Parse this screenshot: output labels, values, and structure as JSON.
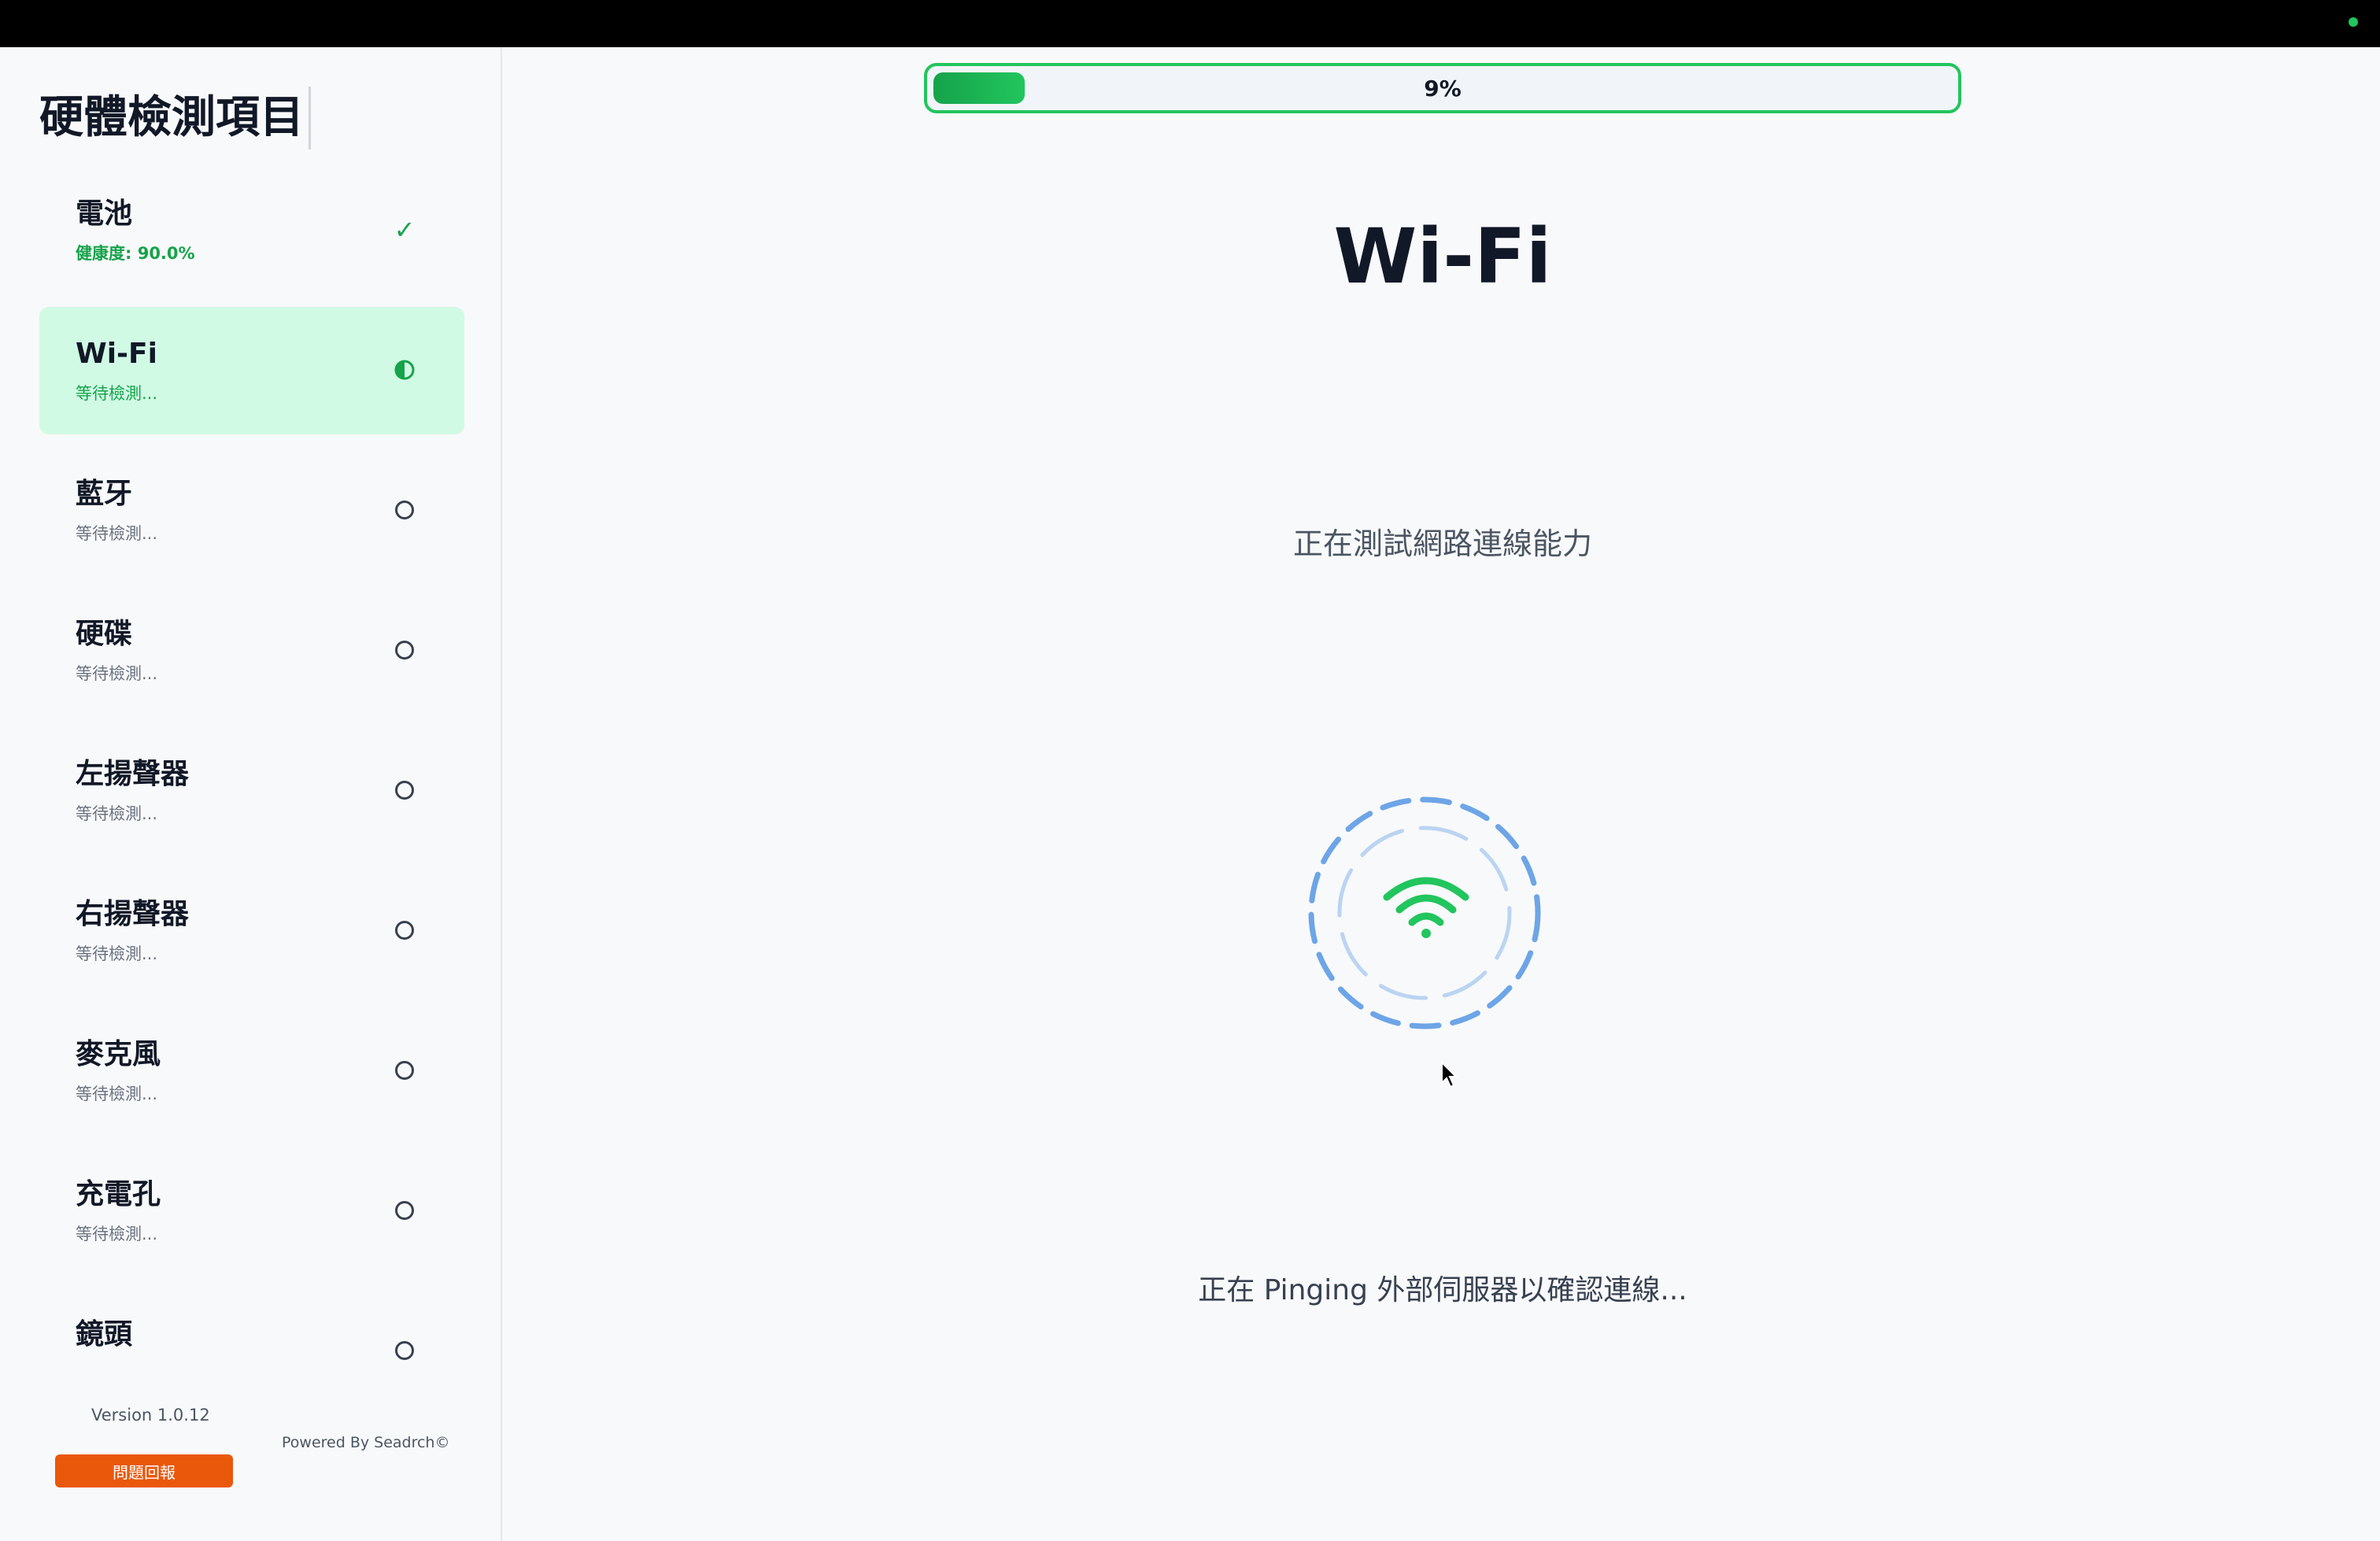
{
  "window": {
    "status_color": "#22c55e"
  },
  "sidebar": {
    "title": "硬體檢測項目",
    "items": [
      {
        "name": "電池",
        "status": "健康度: 90.0%",
        "state": "done",
        "icon": "check-icon"
      },
      {
        "name": "Wi-Fi",
        "status": "等待檢測...",
        "state": "active",
        "icon": "half-circle-icon"
      },
      {
        "name": "藍牙",
        "status": "等待檢測...",
        "state": "waiting",
        "icon": "circle-icon"
      },
      {
        "name": "硬碟",
        "status": "等待檢測...",
        "state": "waiting",
        "icon": "circle-icon"
      },
      {
        "name": "左揚聲器",
        "status": "等待檢測...",
        "state": "waiting",
        "icon": "circle-icon"
      },
      {
        "name": "右揚聲器",
        "status": "等待檢測...",
        "state": "waiting",
        "icon": "circle-icon"
      },
      {
        "name": "麥克風",
        "status": "等待檢測...",
        "state": "waiting",
        "icon": "circle-icon"
      },
      {
        "name": "充電孔",
        "status": "等待檢測...",
        "state": "waiting",
        "icon": "circle-icon"
      },
      {
        "name": "鏡頭",
        "status": "",
        "state": "waiting",
        "icon": "circle-icon"
      }
    ],
    "version": "Version 1.0.12",
    "powered_by": "Powered By Seadrch©",
    "report_button": "問題回報"
  },
  "main": {
    "progress": {
      "percent": 9,
      "label": "9%"
    },
    "title": "Wi-Fi",
    "subtitle": "正在測試網路連線能力",
    "message": "正在 Pinging 外部伺服器以確認連線..."
  },
  "colors": {
    "accent": "#22c55e",
    "active_bg": "#d1fae5",
    "report_button": "#ea580c",
    "spinner": "#4a90e2"
  }
}
